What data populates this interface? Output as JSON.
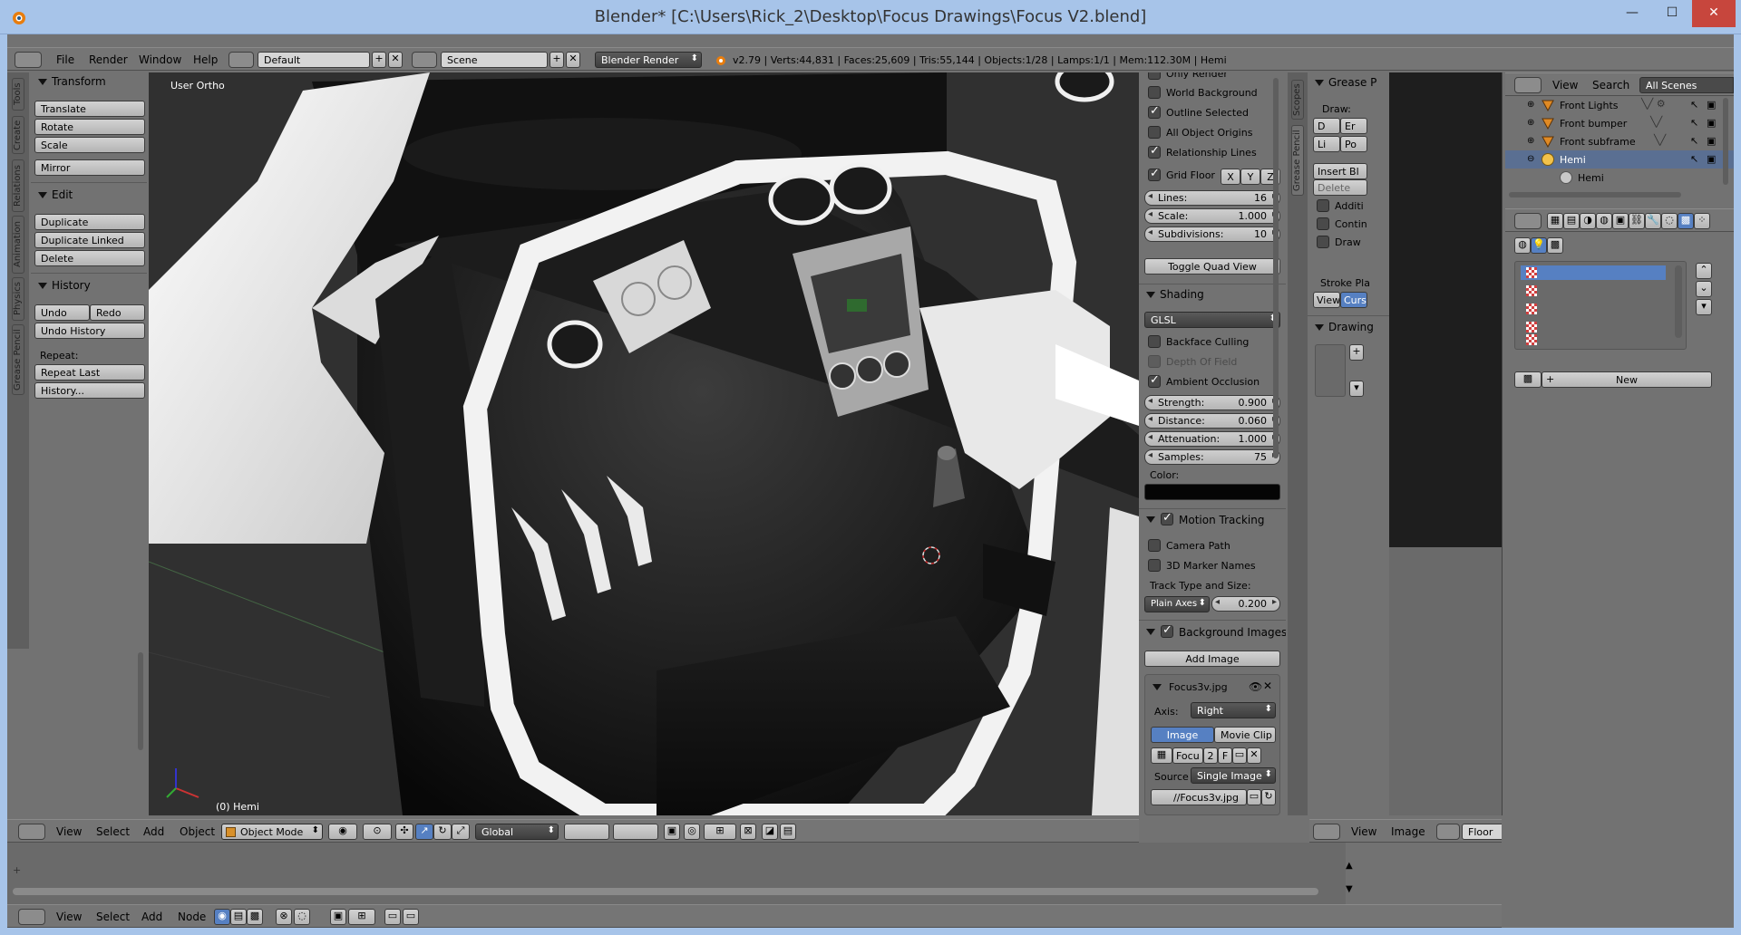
{
  "window": {
    "title": "Blender* [C:\\Users\\Rick_2\\Desktop\\Focus Drawings\\Focus V2.blend]",
    "min": "—",
    "max": "☐",
    "close": "✕"
  },
  "info_header": {
    "menus": [
      "File",
      "Render",
      "Window",
      "Help"
    ],
    "layout": "Default",
    "scene": "Scene",
    "engine": "Blender Render",
    "stats": "v2.79 | Verts:44,831 | Faces:25,609 | Tris:55,144 | Objects:1/28 | Lamps:1/1 | Mem:112.30M | Hemi"
  },
  "tool_tabs": [
    "Tools",
    "Create",
    "Relations",
    "Animation",
    "Physics",
    "Grease Pencil"
  ],
  "toolshelf": {
    "transform": {
      "title": "Transform",
      "buttons": [
        "Translate",
        "Rotate",
        "Scale",
        "Mirror"
      ]
    },
    "edit": {
      "title": "Edit",
      "buttons": [
        "Duplicate",
        "Duplicate Linked",
        "Delete"
      ]
    },
    "history": {
      "title": "History",
      "undo": "Undo",
      "redo": "Redo",
      "undo_history": "Undo History",
      "repeat": "Repeat:",
      "repeat_last": "Repeat Last",
      "history_btn": "History..."
    }
  },
  "viewport": {
    "view_label": "User Ortho",
    "object_label": "(0) Hemi"
  },
  "viewport_header": {
    "menus": [
      "View",
      "Select",
      "Add",
      "Object"
    ],
    "mode": "Object Mode",
    "orientation": "Global"
  },
  "properties": {
    "display": {
      "only_render": "Only Render",
      "world_background": "World Background",
      "outline_selected": "Outline Selected",
      "all_object_origins": "All Object Origins",
      "relationship_lines": "Relationship Lines",
      "grid_floor": "Grid Floor",
      "axes": [
        "X",
        "Y",
        "Z"
      ],
      "lines_label": "Lines:",
      "lines_value": "16",
      "scale_label": "Scale:",
      "scale_value": "1.000",
      "subdiv_label": "Subdivisions:",
      "subdiv_value": "10",
      "toggle_quad": "Toggle Quad View"
    },
    "shading": {
      "title": "Shading",
      "mode": "GLSL",
      "backface": "Backface Culling",
      "dof": "Depth Of Field",
      "ao": "Ambient Occlusion",
      "strength_label": "Strength:",
      "strength_value": "0.900",
      "distance_label": "Distance:",
      "distance_value": "0.060",
      "attenuation_label": "Attenuation:",
      "attenuation_value": "1.000",
      "samples_label": "Samples:",
      "samples_value": "75",
      "color_label": "Color:",
      "color": "#050505"
    },
    "motion_tracking": {
      "title": "Motion Tracking",
      "camera_path": "Camera Path",
      "marker_names": "3D Marker Names",
      "track_type_label": "Track Type and Size:",
      "track_type": "Plain Axes",
      "track_size": "0.200"
    },
    "background_images": {
      "title": "Background Images",
      "add_image": "Add Image",
      "image_name": "Focus3v.jpg",
      "axis_label": "Axis:",
      "axis_value": "Right",
      "tab_image": "Image",
      "tab_movie": "Movie Clip",
      "image_short": "Focu",
      "users": "2",
      "fake": "F",
      "source_label": "Source",
      "source_value": "Single Image",
      "path": "//Focus3v.jpg"
    }
  },
  "gp_tabs": [
    "Scopes",
    "Grease Pencil"
  ],
  "grease_pencil": {
    "title": "Grease P",
    "draw_label": "Draw:",
    "btn_draw": "D",
    "btn_erase": "Er",
    "btn_line": "Li",
    "btn_poly": "Po",
    "insert": "Insert Bl",
    "delete": "Delete",
    "additive": "Additi",
    "continuous": "Contin",
    "draw_chk": "Draw",
    "stroke_placement": "Stroke Pla",
    "view": "View",
    "cursor": "Curso",
    "drawing": "Drawing"
  },
  "outliner": {
    "menus": [
      "View",
      "Search"
    ],
    "filter": "All Scenes",
    "items": [
      {
        "label": "Front Lights",
        "type": "mesh"
      },
      {
        "label": "Front bumper",
        "type": "mesh"
      },
      {
        "label": "Front subframe",
        "type": "mesh"
      },
      {
        "label": "Hemi",
        "type": "lamp"
      },
      {
        "label": "Hemi",
        "type": "lamp-data"
      }
    ]
  },
  "texture_panel": {
    "new_button": "New"
  },
  "image_editor_header": {
    "menus": [
      "View",
      "Image"
    ],
    "slot": "Floor"
  },
  "timeline_header": {
    "menus": [
      "View",
      "Select",
      "Add",
      "Node"
    ]
  }
}
